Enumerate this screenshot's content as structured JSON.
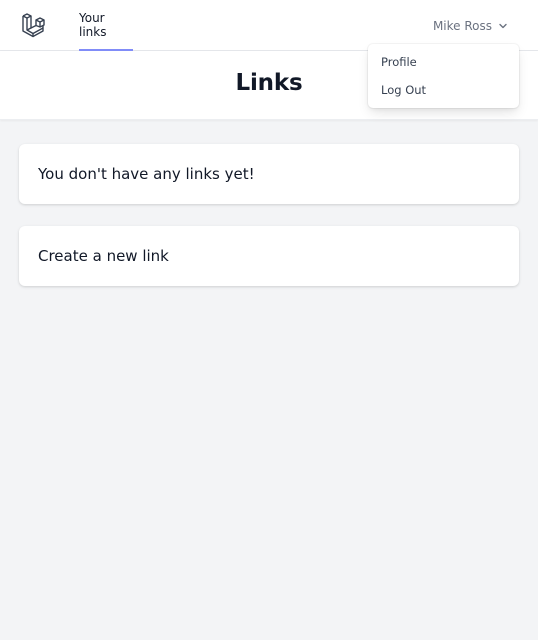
{
  "nav": {
    "logo_icon": "laravel-logo-icon",
    "links": [
      {
        "label": "Your links",
        "active": true
      }
    ],
    "user": {
      "name": "Mike Ross",
      "chevron_icon": "chevron-down-icon"
    },
    "accent_color": "#818cf8"
  },
  "dropdown": {
    "open": true,
    "items": [
      {
        "label": "Profile"
      },
      {
        "label": "Log Out"
      }
    ]
  },
  "header": {
    "title": "Links"
  },
  "main": {
    "empty_message": "You don't have any links yet!",
    "create_link_label": "Create a new link"
  }
}
